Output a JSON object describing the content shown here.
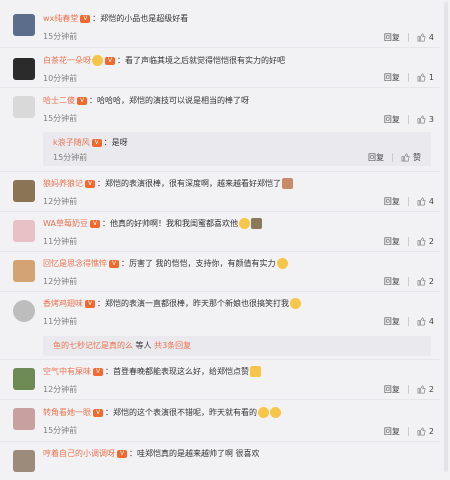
{
  "comments": [
    {
      "user": "wx纯春堂",
      "text": "：郑恺的小品也是超级好看",
      "time": "15分钟前",
      "reply": "回复",
      "likes": "4",
      "avatar": "#5b6d8a"
    },
    {
      "user": "白茶花一朵呀",
      "text": "：看了声临其境之后就觉得恺恺很有实力的好吧",
      "time": "10分钟前",
      "reply": "回复",
      "likes": "1",
      "avatar": "#2b2b2b"
    },
    {
      "user": "哈士二傻",
      "text": "：哈哈哈，郑恺的演技可以说是相当的棒了呀",
      "time": "15分钟前",
      "reply": "回复",
      "likes": "3",
      "avatar": "#d9d9d9"
    },
    {
      "user": "狼妈养狼记",
      "text": "：郑恺的表演很棒，很有深度啊，越来越看好郑恺了",
      "time": "12分钟前",
      "reply": "回复",
      "likes": "4",
      "avatar": "#8b7355"
    },
    {
      "user": "WA草莓奶豆",
      "text": "：他真的好帅啊！我和我闺蜜都喜欢他",
      "time": "11分钟前",
      "reply": "回复",
      "likes": "2",
      "avatar": "#e8c1c6"
    },
    {
      "user": "回忆是思念得憔悴",
      "text": "：厉害了  我的恺恺，支持你，有颜值有实力",
      "time": "12分钟前",
      "reply": "回复",
      "likes": "2",
      "avatar": "#d4a373"
    },
    {
      "user": "香烤鸡翅味",
      "text": "：郑恺的表演一直都很棒，昨天那个新娘也很搞笑打我",
      "time": "11分钟前",
      "reply": "回复",
      "likes": "4",
      "avatar": "#bdbdbd"
    },
    {
      "user": "空气中有屎味",
      "text": "：首登春晚都能表现这么好，给郑恺点赞",
      "time": "12分钟前",
      "reply": "回复",
      "likes": "2",
      "avatar": "#6d8a55"
    },
    {
      "user": "转角看她一眼",
      "text": "：郑恺的这个表演很不错呢，昨天就有看的",
      "time": "15分钟前",
      "reply": "回复",
      "likes": "2",
      "avatar": "#c9a0a0"
    },
    {
      "user": "哼着自己的小调调呀",
      "text": "：哇郑恺真的是越来越帅了啊  很喜欢",
      "time": "12分钟前",
      "reply": "",
      "likes": "",
      "avatar": "#9c8b7a"
    }
  ],
  "sub_reply": {
    "user": "k浪子随风",
    "text": "：是呀",
    "time": "15分钟前",
    "reply": "回复",
    "like_label": "赞"
  },
  "more": {
    "user": "鱼的七秒记忆是真的么",
    "mid": " 等人 ",
    "link": "共3条回复"
  }
}
